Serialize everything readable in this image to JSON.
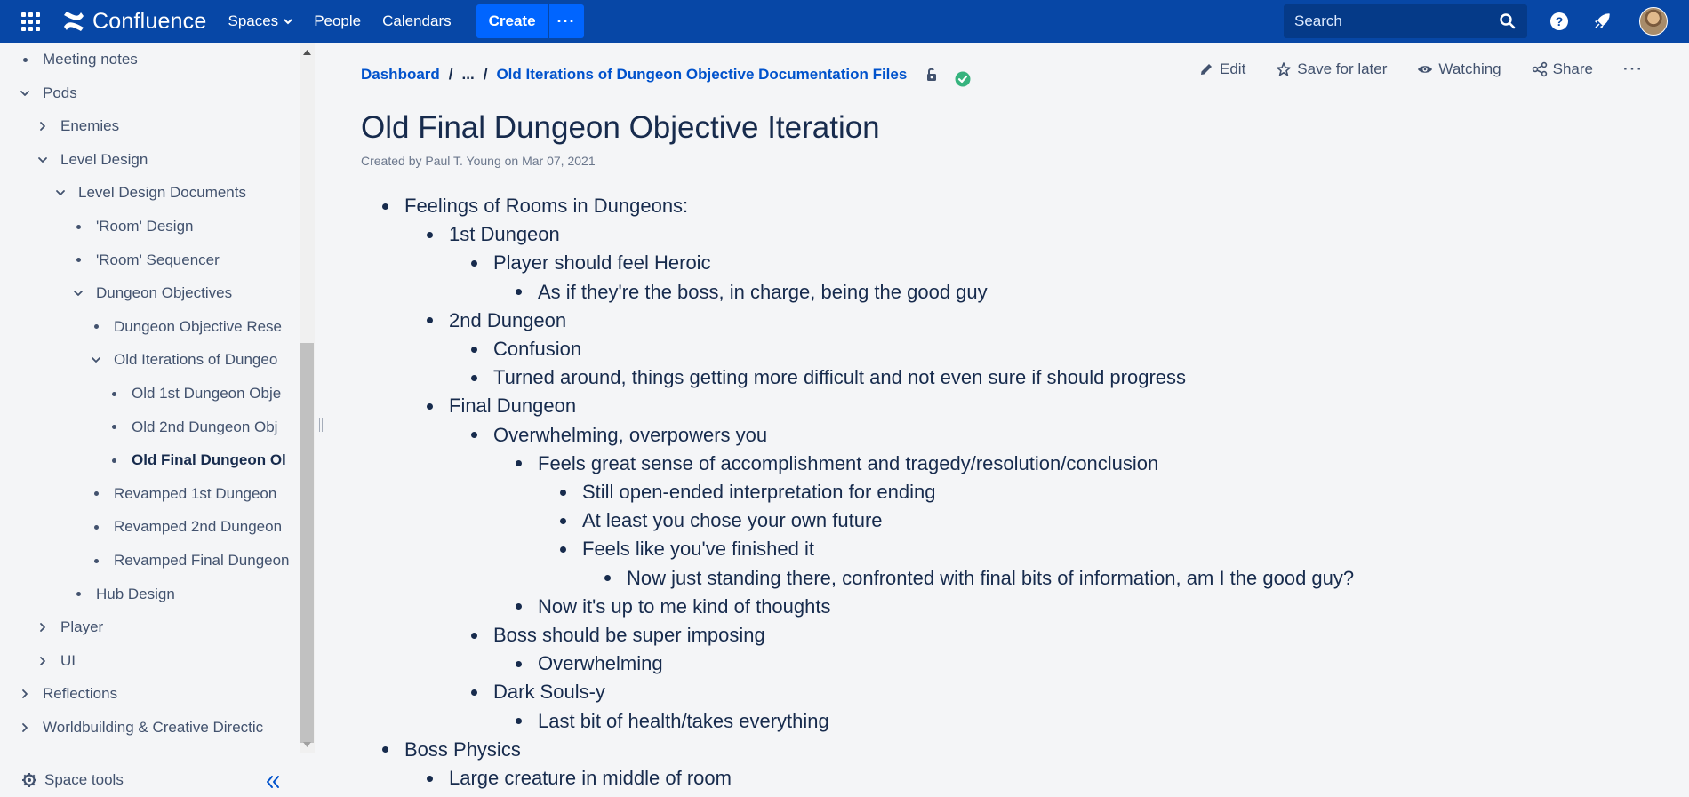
{
  "topnav": {
    "logo_text": "Confluence",
    "nav": [
      {
        "label": "Spaces",
        "dropdown": true
      },
      {
        "label": "People",
        "dropdown": false
      },
      {
        "label": "Calendars",
        "dropdown": false
      }
    ],
    "create_label": "Create",
    "search_placeholder": "Search",
    "accent_color": "#0747a6"
  },
  "sidebar": {
    "items": [
      {
        "label": "Meeting notes",
        "level": 0,
        "type": "leaf"
      },
      {
        "label": "Pods",
        "level": 0,
        "type": "expanded"
      },
      {
        "label": "Enemies",
        "level": 1,
        "type": "collapsed"
      },
      {
        "label": "Level Design",
        "level": 1,
        "type": "expanded"
      },
      {
        "label": "Level Design Documents",
        "level": 2,
        "type": "expanded"
      },
      {
        "label": "'Room' Design",
        "level": 3,
        "type": "leaf"
      },
      {
        "label": "'Room' Sequencer",
        "level": 3,
        "type": "leaf"
      },
      {
        "label": "Dungeon Objectives",
        "level": 3,
        "type": "expanded"
      },
      {
        "label": "Dungeon Objective Rese",
        "level": 4,
        "type": "leaf"
      },
      {
        "label": "Old Iterations of Dungeo",
        "level": 4,
        "type": "expanded"
      },
      {
        "label": "Old 1st Dungeon Obje",
        "level": 5,
        "type": "leaf"
      },
      {
        "label": "Old 2nd Dungeon Obj",
        "level": 5,
        "type": "leaf"
      },
      {
        "label": "Old Final Dungeon Ol",
        "level": 5,
        "type": "leaf",
        "active": true
      },
      {
        "label": "Revamped 1st Dungeon",
        "level": 4,
        "type": "leaf"
      },
      {
        "label": "Revamped 2nd Dungeon",
        "level": 4,
        "type": "leaf"
      },
      {
        "label": "Revamped Final Dungeon",
        "level": 4,
        "type": "leaf"
      },
      {
        "label": "Hub Design",
        "level": 3,
        "type": "leaf"
      },
      {
        "label": "Player",
        "level": 1,
        "type": "collapsed"
      },
      {
        "label": "UI",
        "level": 1,
        "type": "collapsed"
      },
      {
        "label": "Reflections",
        "level": 0,
        "type": "collapsed"
      },
      {
        "label": "Worldbuilding & Creative Directic",
        "level": 0,
        "type": "collapsed"
      }
    ],
    "space_tools_label": "Space tools"
  },
  "breadcrumb": {
    "root": "Dashboard",
    "ellipsis": "...",
    "parent": "Old Iterations of Dungeon Objective Documentation Files"
  },
  "actions": {
    "edit": "Edit",
    "save_for_later": "Save for later",
    "watching": "Watching",
    "share": "Share",
    "more": "···"
  },
  "page": {
    "title": "Old Final Dungeon Objective Iteration",
    "byline": "Created by Paul T. Young on Mar 07, 2021",
    "content": [
      {
        "text": "Feelings of Rooms in Dungeons:",
        "level": 0
      },
      {
        "text": "1st Dungeon",
        "level": 1
      },
      {
        "text": "Player should feel Heroic",
        "level": 2
      },
      {
        "text": "As if they're the boss, in charge, being the good guy",
        "level": 3
      },
      {
        "text": "2nd Dungeon",
        "level": 1
      },
      {
        "text": "Confusion",
        "level": 2
      },
      {
        "text": "Turned around, things getting more difficult and not even sure if should progress",
        "level": 2
      },
      {
        "text": "Final Dungeon",
        "level": 1
      },
      {
        "text": "Overwhelming, overpowers you",
        "level": 2
      },
      {
        "text": "Feels great sense of accomplishment and tragedy/resolution/conclusion",
        "level": 3
      },
      {
        "text": "Still open-ended interpretation for ending",
        "level": 4
      },
      {
        "text": "At least you chose your own future",
        "level": 4
      },
      {
        "text": "Feels like you've finished it",
        "level": 4
      },
      {
        "text": "Now just standing there, confronted with final bits of information, am I the good guy?",
        "level": 5
      },
      {
        "text": "Now it's up to me kind of thoughts",
        "level": 3
      },
      {
        "text": "Boss should be super imposing",
        "level": 2
      },
      {
        "text": "Overwhelming",
        "level": 3
      },
      {
        "text": "Dark Souls-y",
        "level": 2
      },
      {
        "text": "Last bit of health/takes everything",
        "level": 3
      },
      {
        "text": "Boss Physics",
        "level": 0
      },
      {
        "text": "Large creature in middle of room",
        "level": 1
      }
    ]
  }
}
